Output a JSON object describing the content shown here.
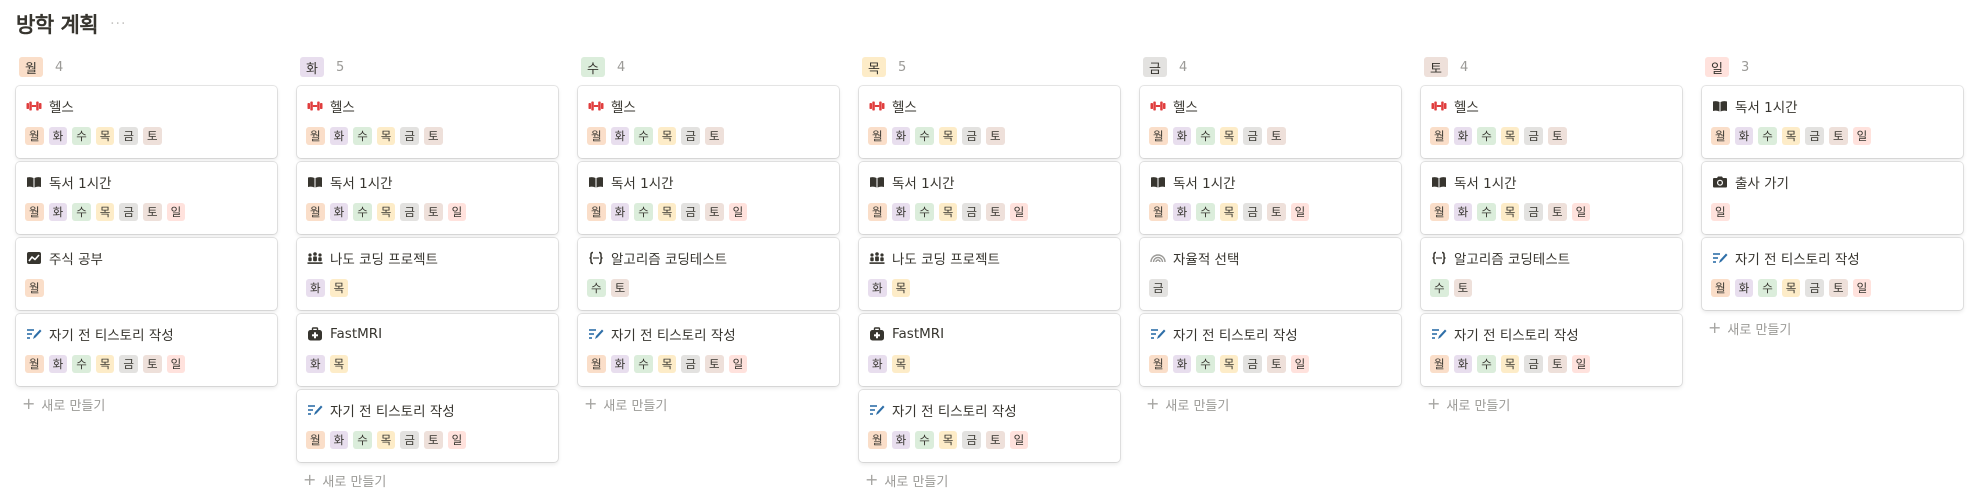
{
  "page": {
    "title": "방학 계획",
    "more": "···"
  },
  "new_label": "새로 만들기",
  "day_colors": {
    "월": "#fadec9",
    "화": "#e8deee",
    "수": "#dbeddb",
    "목": "#fdecc8",
    "금": "#e3e2e0",
    "토": "#eee0da",
    "일": "#ffe2dd"
  },
  "columns": [
    {
      "day": "월",
      "count": "4",
      "cards": [
        {
          "icon": "dumbbell-icon",
          "title": "헬스",
          "tags": [
            "월",
            "화",
            "수",
            "목",
            "금",
            "토"
          ]
        },
        {
          "icon": "book-icon",
          "title": "독서 1시간",
          "tags": [
            "월",
            "화",
            "수",
            "목",
            "금",
            "토",
            "일"
          ]
        },
        {
          "icon": "trend-chart-icon",
          "title": "주식 공부",
          "tags": [
            "월"
          ]
        },
        {
          "icon": "write-icon",
          "title": "자기 전 티스토리 작성",
          "tags": [
            "월",
            "화",
            "수",
            "목",
            "금",
            "토",
            "일"
          ]
        }
      ]
    },
    {
      "day": "화",
      "count": "5",
      "cards": [
        {
          "icon": "dumbbell-icon",
          "title": "헬스",
          "tags": [
            "월",
            "화",
            "수",
            "목",
            "금",
            "토"
          ]
        },
        {
          "icon": "book-icon",
          "title": "독서 1시간",
          "tags": [
            "월",
            "화",
            "수",
            "목",
            "금",
            "토",
            "일"
          ]
        },
        {
          "icon": "people-icon",
          "title": "나도 코딩 프로젝트",
          "tags": [
            "화",
            "목"
          ]
        },
        {
          "icon": "medkit-icon",
          "title": "FastMRI",
          "tags": [
            "화",
            "목"
          ]
        },
        {
          "icon": "write-icon",
          "title": "자기 전 티스토리 작성",
          "tags": [
            "월",
            "화",
            "수",
            "목",
            "금",
            "토",
            "일"
          ]
        }
      ]
    },
    {
      "day": "수",
      "count": "4",
      "cards": [
        {
          "icon": "dumbbell-icon",
          "title": "헬스",
          "tags": [
            "월",
            "화",
            "수",
            "목",
            "금",
            "토"
          ]
        },
        {
          "icon": "book-icon",
          "title": "독서 1시간",
          "tags": [
            "월",
            "화",
            "수",
            "목",
            "금",
            "토",
            "일"
          ]
        },
        {
          "icon": "code-braces-icon",
          "title": "알고리즘 코딩테스트",
          "tags": [
            "수",
            "토"
          ]
        },
        {
          "icon": "write-icon",
          "title": "자기 전 티스토리 작성",
          "tags": [
            "월",
            "화",
            "수",
            "목",
            "금",
            "토",
            "일"
          ]
        }
      ]
    },
    {
      "day": "목",
      "count": "5",
      "cards": [
        {
          "icon": "dumbbell-icon",
          "title": "헬스",
          "tags": [
            "월",
            "화",
            "수",
            "목",
            "금",
            "토"
          ]
        },
        {
          "icon": "book-icon",
          "title": "독서 1시간",
          "tags": [
            "월",
            "화",
            "수",
            "목",
            "금",
            "토",
            "일"
          ]
        },
        {
          "icon": "people-icon",
          "title": "나도 코딩 프로젝트",
          "tags": [
            "화",
            "목"
          ]
        },
        {
          "icon": "medkit-icon",
          "title": "FastMRI",
          "tags": [
            "화",
            "목"
          ]
        },
        {
          "icon": "write-icon",
          "title": "자기 전 티스토리 작성",
          "tags": [
            "월",
            "화",
            "수",
            "목",
            "금",
            "토",
            "일"
          ]
        }
      ]
    },
    {
      "day": "금",
      "count": "4",
      "cards": [
        {
          "icon": "dumbbell-icon",
          "title": "헬스",
          "tags": [
            "월",
            "화",
            "수",
            "목",
            "금",
            "토"
          ]
        },
        {
          "icon": "book-icon",
          "title": "독서 1시간",
          "tags": [
            "월",
            "화",
            "수",
            "목",
            "금",
            "토",
            "일"
          ]
        },
        {
          "icon": "rainbow-icon",
          "title": "자율적 선택",
          "tags": [
            "금"
          ]
        },
        {
          "icon": "write-icon",
          "title": "자기 전 티스토리 작성",
          "tags": [
            "월",
            "화",
            "수",
            "목",
            "금",
            "토",
            "일"
          ]
        }
      ]
    },
    {
      "day": "토",
      "count": "4",
      "cards": [
        {
          "icon": "dumbbell-icon",
          "title": "헬스",
          "tags": [
            "월",
            "화",
            "수",
            "목",
            "금",
            "토"
          ]
        },
        {
          "icon": "book-icon",
          "title": "독서 1시간",
          "tags": [
            "월",
            "화",
            "수",
            "목",
            "금",
            "토",
            "일"
          ]
        },
        {
          "icon": "code-braces-icon",
          "title": "알고리즘 코딩테스트",
          "tags": [
            "수",
            "토"
          ]
        },
        {
          "icon": "write-icon",
          "title": "자기 전 티스토리 작성",
          "tags": [
            "월",
            "화",
            "수",
            "목",
            "금",
            "토",
            "일"
          ]
        }
      ]
    },
    {
      "day": "일",
      "count": "3",
      "cards": [
        {
          "icon": "book-icon",
          "title": "독서 1시간",
          "tags": [
            "월",
            "화",
            "수",
            "목",
            "금",
            "토",
            "일"
          ]
        },
        {
          "icon": "camera-icon",
          "title": "출사 가기",
          "tags": [
            "일"
          ]
        },
        {
          "icon": "write-icon",
          "title": "자기 전 티스토리 작성",
          "tags": [
            "월",
            "화",
            "수",
            "목",
            "금",
            "토",
            "일"
          ]
        }
      ]
    }
  ]
}
